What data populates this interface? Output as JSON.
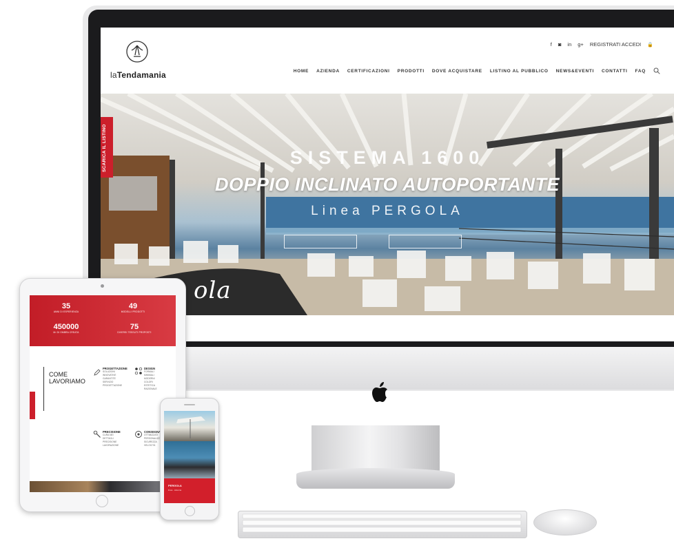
{
  "site": {
    "logo_prefix": "la",
    "logo_name": "Tendamania",
    "top_bar": {
      "facebook": "f",
      "instagram": "◙",
      "linkedin": "in",
      "googleplus": "g+",
      "auth": "REGISTRATI  ACCEDI",
      "lock": "🔒"
    },
    "nav": [
      "HOME",
      "AZIENDA",
      "CERTIFICAZIONI",
      "PRODOTTI",
      "DOVE ACQUISTARE",
      "LISTINO AL PUBBLICO",
      "NEWS&EVENTI",
      "CONTATTI",
      "FAQ"
    ],
    "hero": {
      "line1": "SISTEMA 1600",
      "line2": "DOPPIO INCLINATO AUTOPORTANTE",
      "line3": "Linea PERGOLA",
      "side_tab": "SCARICA IL LISTINO",
      "script": "ola"
    }
  },
  "tablet": {
    "stats": [
      {
        "num": "35",
        "label": "ANNI DI ESPERIENZA"
      },
      {
        "num": "49",
        "label": "MODELLI PRODOTTI"
      },
      {
        "num": "450000",
        "label": "M² DI OMBRA CREATA"
      },
      {
        "num": "75",
        "label": "DIVERSI TESSUTI PROPOSTI"
      }
    ],
    "section_title_1": "COME",
    "section_title_2": "LAVORIAMO",
    "columns": [
      {
        "title": "PROGETTAZIONE",
        "items": "SOLUZIONI\nINNOVATIVE\nGARANTITE\nSERVIZIO\nPROGETTAZIONE"
      },
      {
        "title": "DESIGN",
        "items": "FORMALI\nMINIMALI\nMODERNI\nCOLORI\nESTETICA\nRAZIONALE"
      },
      {
        "title": "PRECISIONE",
        "items": "CURA NEI\nDETTAGLI\nPRECISIONE\nLAVORAZIONE"
      },
      {
        "title": "CONSEGNA E MONTAGGIO",
        "items": "OTTIMIZZATI\nPERSONALIZZ.\nSICUREZZA\nVELOCITÀ"
      }
    ]
  },
  "phone": {
    "title": "PERGOLA",
    "subtitle": "linea  .  sistema"
  },
  "colors": {
    "brand_red": "#cc1f2b",
    "screen_dark": "#1b1b1d"
  }
}
